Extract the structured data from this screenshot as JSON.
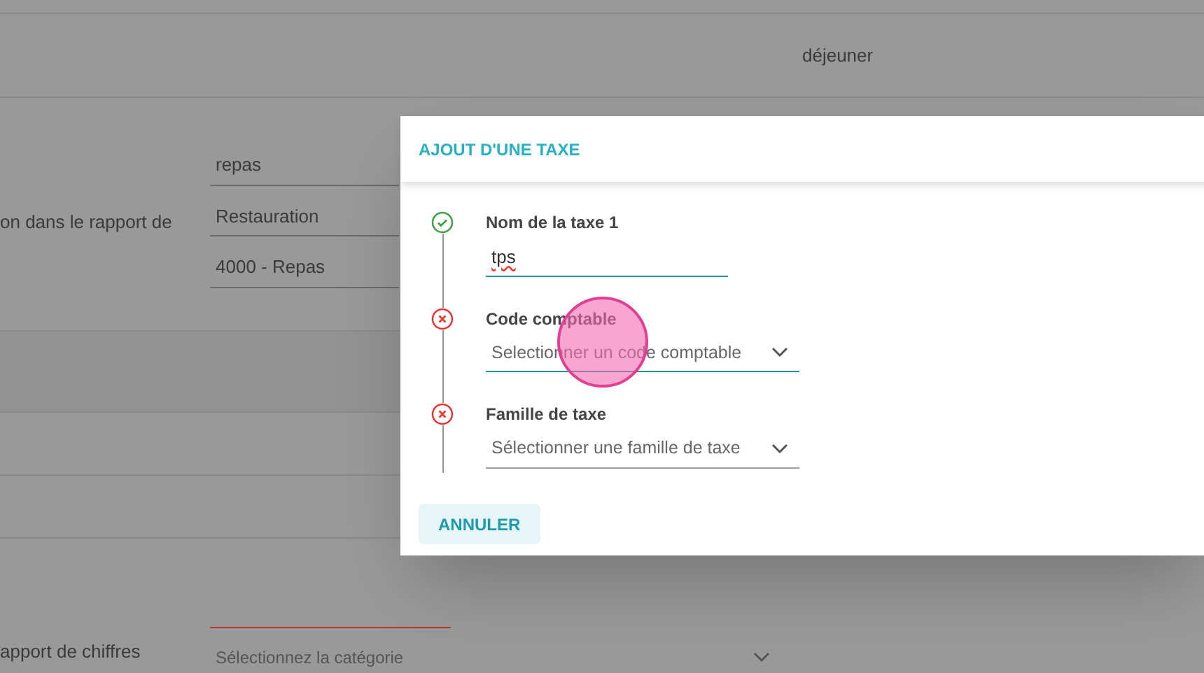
{
  "background": {
    "meal_label": "déjeuner",
    "report_label": "on dans le rapport de",
    "fields": [
      "repas",
      "Restauration",
      "4000 - Repas"
    ],
    "figures_label": "apport de chiffres",
    "category_select": {
      "placeholder": "Sélectionnez la catégorie"
    }
  },
  "dialog": {
    "title": "AJOUT D'UNE TAXE",
    "steps": [
      {
        "label": "Nom de la taxe 1",
        "valid": true,
        "kind": "text",
        "value": "tps",
        "highlighted": true
      },
      {
        "label": "Code comptable",
        "valid": false,
        "kind": "select",
        "placeholder": "Selectionner un code comptable",
        "highlighted": true
      },
      {
        "label": "Famille de taxe",
        "valid": false,
        "kind": "select",
        "placeholder": "Sélectionner une famille de taxe",
        "highlighted": false
      }
    ],
    "cancel_button": "ANNULER"
  }
}
